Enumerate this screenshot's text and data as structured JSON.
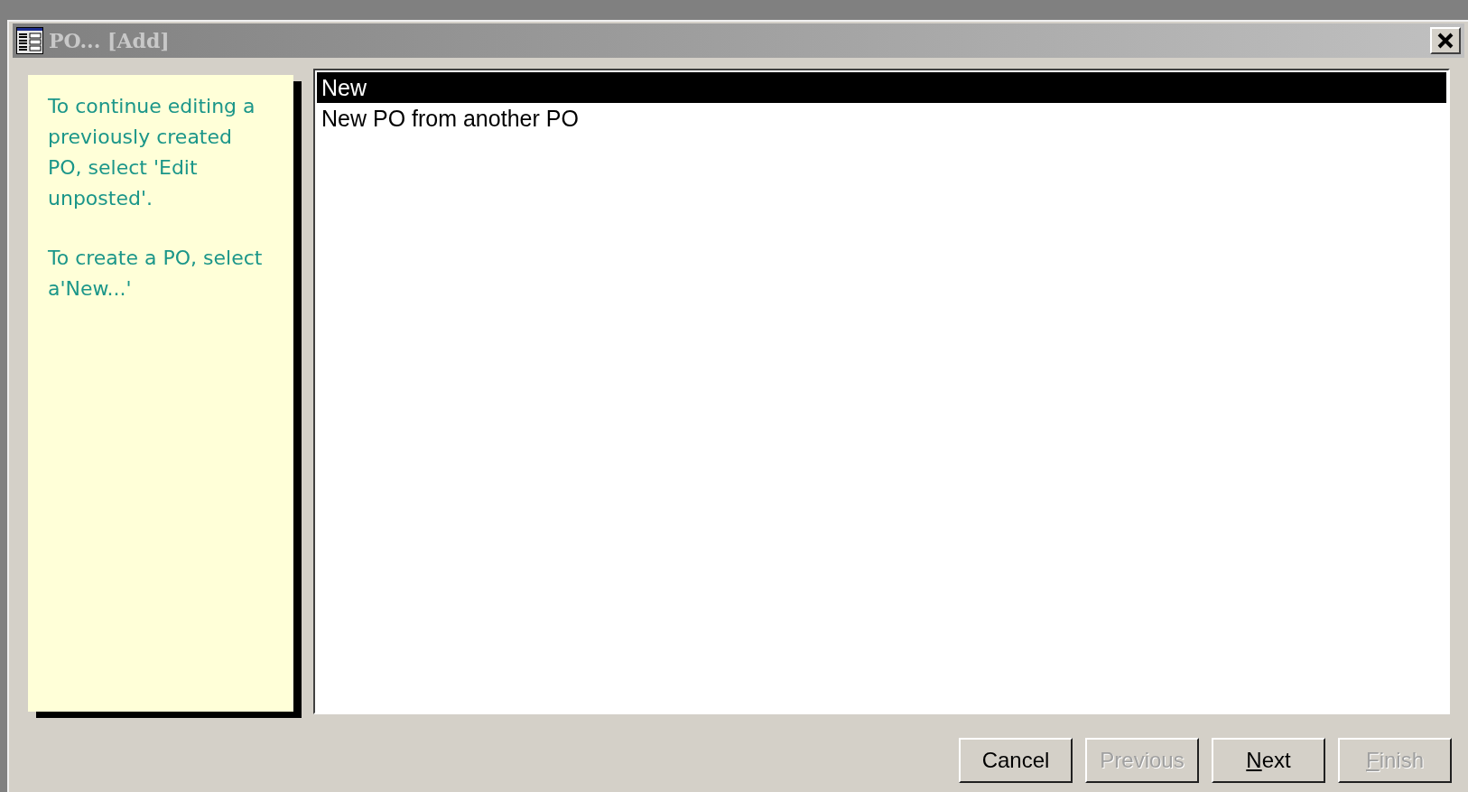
{
  "window": {
    "title": "PO... [Add]"
  },
  "note": {
    "paragraphs": [
      "To continue editing a previously created PO, select 'Edit unposted'.",
      "To create a PO, select a'New...'"
    ]
  },
  "list": {
    "items": [
      {
        "label": "New",
        "selected": true
      },
      {
        "label": "New PO from another PO",
        "selected": false
      }
    ]
  },
  "buttons": [
    {
      "label": "Cancel",
      "disabled": false,
      "mnemonic": false
    },
    {
      "label": "Previous",
      "disabled": true,
      "mnemonic": false
    },
    {
      "label": "Next",
      "disabled": false,
      "mnemonic": true
    },
    {
      "label": "Finish",
      "disabled": true,
      "mnemonic": true
    }
  ]
}
